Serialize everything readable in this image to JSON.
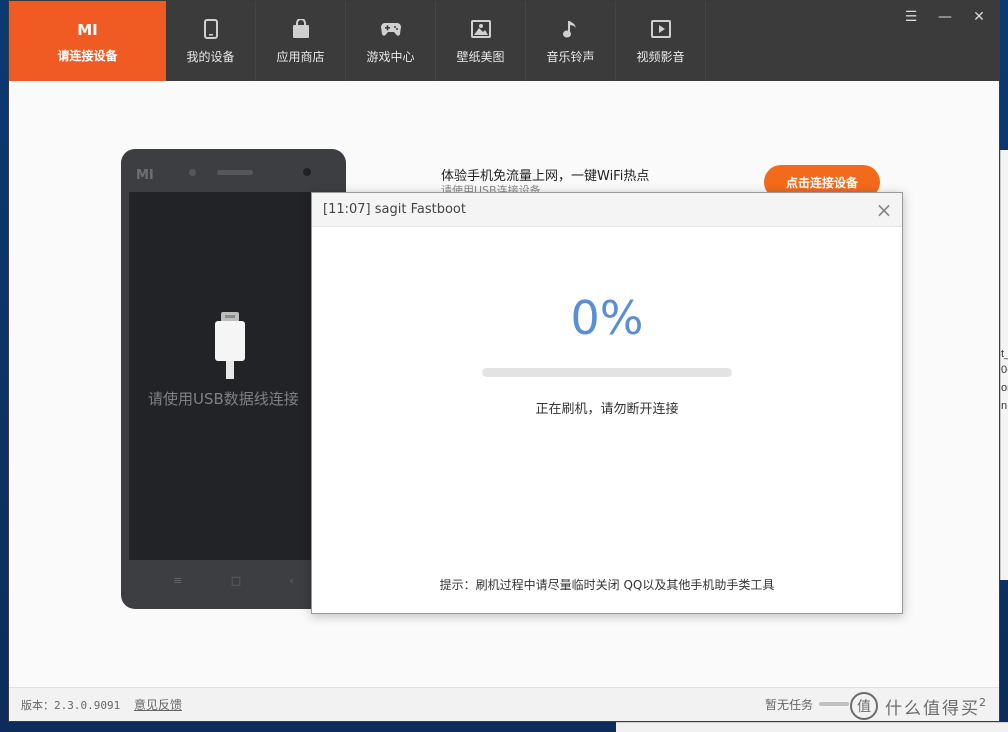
{
  "nav": {
    "active": {
      "label": "请连接设备",
      "logo": "MI"
    },
    "items": [
      {
        "label": "我的设备",
        "icon": "phone-icon"
      },
      {
        "label": "应用商店",
        "icon": "bag-icon"
      },
      {
        "label": "游戏中心",
        "icon": "gamepad-icon"
      },
      {
        "label": "壁纸美图",
        "icon": "image-icon"
      },
      {
        "label": "音乐铃声",
        "icon": "music-note-icon"
      },
      {
        "label": "视频影音",
        "icon": "video-play-icon"
      }
    ],
    "window_controls": {
      "menu": "☰",
      "minimize": "—",
      "close": "✕"
    }
  },
  "phone": {
    "logo": "MI",
    "screen_text": "请使用USB数据线连接",
    "keys": [
      "≡",
      "□",
      "‹"
    ]
  },
  "promo": {
    "title": "体验手机免流量上网，一键WiFi热点",
    "subtitle": "请使用USB连接设备",
    "button_label": "点击连接设备"
  },
  "dialog": {
    "title": "[11:07] sagit Fastboot",
    "percent_text": "0%",
    "progress": 0,
    "status": "正在刷机，请勿断开连接",
    "tip": "提示：刷机过程中请尽量临时关闭 QQ以及其他手机助手类工具"
  },
  "statusbar": {
    "version": "版本：2.3.0.9091",
    "feedback": "意见反馈",
    "tasks": "暂无任务",
    "page": "2"
  },
  "watermark": {
    "text": "什么值得买",
    "logo_char": "值"
  },
  "desktop": {
    "fragments": [
      "t_",
      "0-",
      "on",
      "n"
    ]
  },
  "colors": {
    "accent": "#ef5b23",
    "topbar": "#3b3b3b",
    "progress": "#5a8fd8",
    "button": "#f36a1b"
  }
}
